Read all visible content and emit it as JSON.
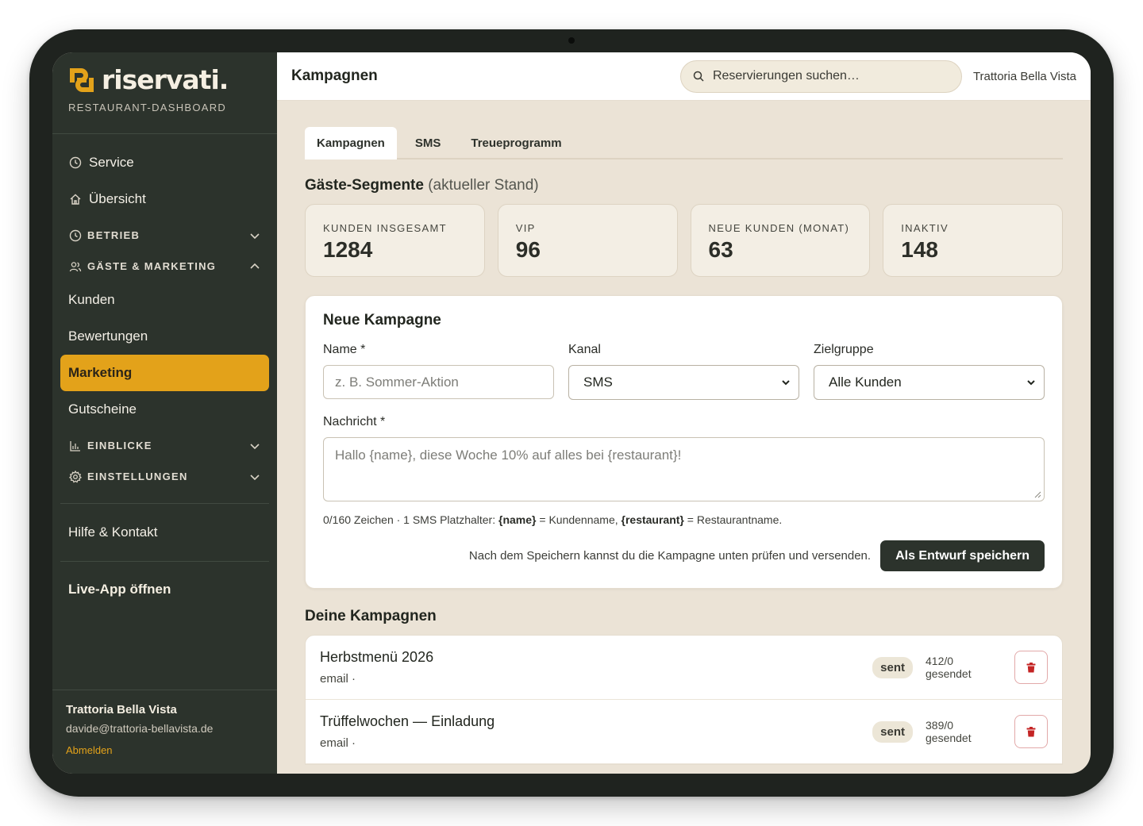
{
  "brand": {
    "name": "riservati.",
    "subtitle": "RESTAURANT-DASHBOARD",
    "accent_color": "#e3a21a",
    "sidebar_color": "#2c332c"
  },
  "sidebar": {
    "top_items": [
      {
        "label": "Service",
        "icon": "clock-icon"
      },
      {
        "label": "Übersicht",
        "icon": "home-icon"
      }
    ],
    "groups": {
      "betrieb": {
        "label": "BETRIEB",
        "icon": "clock-icon",
        "expanded": false
      },
      "marketing": {
        "label": "GÄSTE & MARKETING",
        "icon": "users-icon",
        "expanded": true
      },
      "einblicke": {
        "label": "EINBLICKE",
        "icon": "bar-chart-icon",
        "expanded": false
      },
      "einstellungen": {
        "label": "EINSTELLUNGEN",
        "icon": "gear-icon",
        "expanded": false
      }
    },
    "marketing_items": [
      "Kunden",
      "Bewertungen",
      "Marketing",
      "Gutscheine"
    ],
    "active_item": "Marketing",
    "help": "Hilfe & Kontakt",
    "live_app": "Live-App öffnen",
    "footer": {
      "restaurant": "Trattoria Bella Vista",
      "email": "davide@trattoria-bellavista.de",
      "logout": "Abmelden"
    }
  },
  "header": {
    "title": "Kampagnen",
    "search_placeholder": "Reservierungen suchen…",
    "tenant": "Trattoria Bella Vista"
  },
  "tabs": [
    {
      "label": "Kampagnen",
      "active": true
    },
    {
      "label": "SMS",
      "active": false
    },
    {
      "label": "Treueprogramm",
      "active": false
    }
  ],
  "segments": {
    "title": "Gäste-Segmente",
    "title_suffix": "(aktueller Stand)",
    "cards": [
      {
        "label": "KUNDEN INSGESAMT",
        "value": "1284"
      },
      {
        "label": "VIP",
        "value": "96"
      },
      {
        "label": "NEUE KUNDEN (MONAT)",
        "value": "63"
      },
      {
        "label": "INAKTIV",
        "value": "148"
      }
    ]
  },
  "new_campaign": {
    "title": "Neue Kampagne",
    "name_label": "Name *",
    "name_placeholder": "z. B. Sommer-Aktion",
    "channel_label": "Kanal",
    "channel_value": "SMS",
    "audience_label": "Zielgruppe",
    "audience_value": "Alle Kunden",
    "message_label": "Nachricht *",
    "message_placeholder": "Hallo {name}, diese Woche 10% auf alles bei {restaurant}!",
    "counter": "0/160 Zeichen · 1 SMS",
    "hint_prefix": "Platzhalter:",
    "hint_name_token": "{name}",
    "hint_name_desc": "= Kundenname,",
    "hint_restaurant_token": "{restaurant}",
    "hint_restaurant_desc": "= Restaurantname.",
    "save_note": "Nach dem Speichern kannst du die Kampagne unten prüfen und versenden.",
    "save_button": "Als Entwurf speichern"
  },
  "campaigns": {
    "title": "Deine Kampagnen",
    "items": [
      {
        "title": "Herbstmenü 2026",
        "channel": "email ·",
        "status": "sent",
        "sent": "412/0 gesendet"
      },
      {
        "title": "Trüffelwochen — Einladung",
        "channel": "email ·",
        "status": "sent",
        "sent": "389/0 gesendet"
      }
    ]
  }
}
